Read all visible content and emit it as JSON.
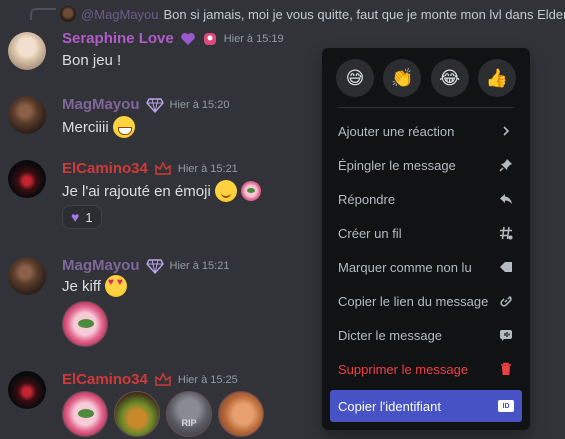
{
  "reply": {
    "author": "@MagMayou",
    "text": "Bon si jamais, moi je vous quitte, faut que je monte mon lvl dans Elder"
  },
  "messages": [
    {
      "author": "Seraphine Love",
      "time": "Hier à 15:19",
      "text": "Bon jeu !"
    },
    {
      "author": "MagMayou",
      "time": "Hier à 15:20",
      "text": "Merciiii"
    },
    {
      "author": "ElCamino34",
      "time": "Hier à 15:21",
      "text": "Je l'ai rajouté en émoji",
      "reaction_count": "1"
    },
    {
      "author": "MagMayou",
      "time": "Hier à 15:21",
      "text": "Je kiff"
    },
    {
      "author": "ElCamino34",
      "time": "Hier à 15:25",
      "rip_label": "RIP"
    }
  ],
  "context_menu": {
    "quick_reactions": [
      "😅",
      "👏",
      "😂",
      "👍"
    ],
    "items": [
      {
        "label": "Ajouter une réaction",
        "icon": "chevron-right-icon"
      },
      {
        "label": "Épingler le message",
        "icon": "pin-icon"
      },
      {
        "label": "Répondre",
        "icon": "reply-icon"
      },
      {
        "label": "Créer un fil",
        "icon": "thread-icon"
      },
      {
        "label": "Marquer comme non lu",
        "icon": "unread-icon"
      },
      {
        "label": "Copier le lien du message",
        "icon": "link-icon"
      },
      {
        "label": "Dicter le message",
        "icon": "speak-icon"
      },
      {
        "label": "Supprimer le message",
        "icon": "trash-icon"
      },
      {
        "label": "Copier l'identifiant",
        "icon": "id-icon"
      }
    ],
    "id_badge": "ID"
  },
  "colors": {
    "background": "#313338",
    "menu": "#111214",
    "accent": "#4752c4",
    "danger": "#f23f42"
  }
}
